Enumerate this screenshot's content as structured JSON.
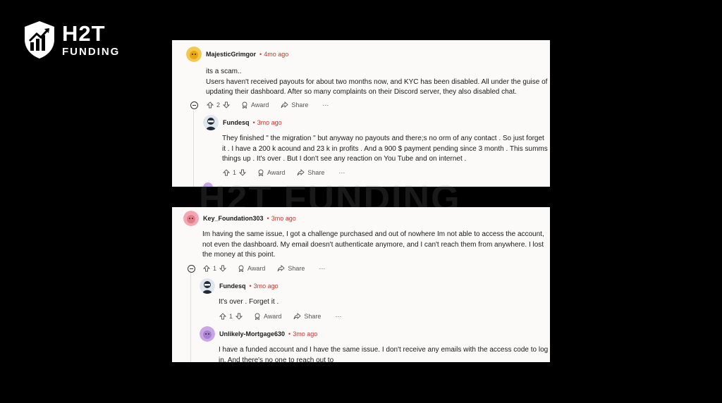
{
  "brand": {
    "name": "H2T",
    "sub": "FUNDING",
    "watermark": "H2T FUNDING"
  },
  "cards": [
    {
      "comments": [
        {
          "author": "MajesticGrimgor",
          "time": "4mo ago",
          "lines": [
            "its a scam..",
            "Users haven't received payouts for about two months now, and KYC has been disabled. All under the guise of",
            "updating their dashboard. After so many complaints on their Discord server, they also disabled chat."
          ],
          "votes": "2",
          "award": "Award",
          "share": "Share",
          "more": "···"
        },
        {
          "author": "Fundesq",
          "time": "3mo ago",
          "lines": [
            "They finished \" the migration \" but anyway no payouts and there;s no orm of any contact . So just forget",
            "it . I have a 200 k acound and 23 k in profits . And a 900 $ payment pending since 3 month . This summs",
            "things up . It's over . But I don't see any reaction on You Tube and on internet ."
          ],
          "votes": "1",
          "award": "Award",
          "share": "Share",
          "more": "···"
        }
      ]
    },
    {
      "comments": [
        {
          "author": "Key_Foundation303",
          "time": "3mo ago",
          "lines": [
            "Im having the same issue, I got a challenge purchased and out of nowhere Im not able to access the account,",
            "not even the dashboard. My email doesn't authenticate anymore, and I can't reach them from anywhere. I lost",
            "the money at this point."
          ],
          "votes": "1",
          "award": "Award",
          "share": "Share",
          "more": "···"
        },
        {
          "author": "Fundesq",
          "time": "3mo ago",
          "lines": [
            "It's over . Forget it ."
          ],
          "votes": "1",
          "award": "Award",
          "share": "Share",
          "more": "···"
        },
        {
          "author": "Unlikely-Mortgage630",
          "time": "3mo ago",
          "lines": [
            "I have a funded account and I have the same issue. I don't receive any emails with the access code to log",
            "in. And there's no one to reach out to"
          ]
        }
      ]
    }
  ],
  "separator": "•"
}
